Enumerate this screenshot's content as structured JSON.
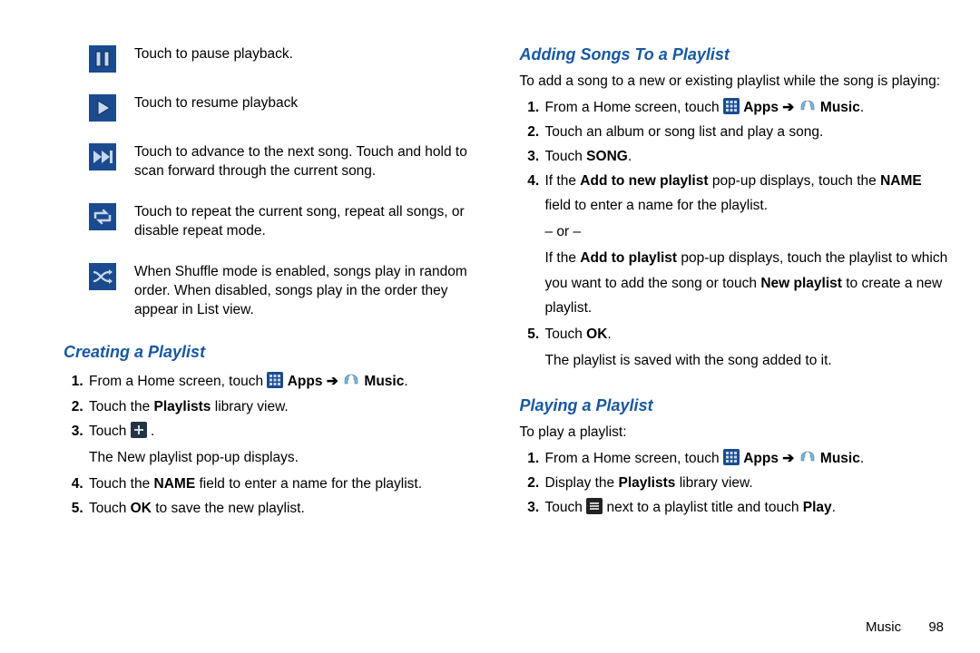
{
  "controls": [
    {
      "text": "Touch to pause playback."
    },
    {
      "text": "Touch to resume playback"
    },
    {
      "text": "Touch to advance to the next song. Touch and hold to scan forward through the current song."
    },
    {
      "text": "Touch to repeat the current song, repeat all songs, or disable repeat mode."
    },
    {
      "text": "When Shuffle mode is enabled, songs play in random order. When disabled, songs play in the order they appear in List view."
    }
  ],
  "creating": {
    "heading": "Creating a Playlist",
    "s1_pre": "From a Home screen, touch ",
    "apps": "Apps",
    "music": "Music",
    "period": ".",
    "s2_pre": "Touch the ",
    "s2_b": "Playlists",
    "s2_post": " library view.",
    "s3_pre": "Touch ",
    "s3_post": " .",
    "s3_sub": "The New playlist pop-up displays.",
    "s4_pre": "Touch the ",
    "s4_b": "NAME",
    "s4_post": " field to enter a name for the playlist.",
    "s5_pre": "Touch ",
    "s5_b": "OK",
    "s5_post": " to save the new playlist."
  },
  "adding": {
    "heading": "Adding Songs To a Playlist",
    "intro": "To add a song to a new or existing playlist while the song is playing:",
    "s1_pre": "From a Home screen, touch ",
    "apps": "Apps",
    "music": "Music",
    "period": ".",
    "s2": "Touch an album or song list and play a song.",
    "s3_pre": "Touch ",
    "s3_b": "SONG",
    "s3_post": ".",
    "s4_pre": "If the ",
    "s4_b1": "Add to new playlist",
    "s4_mid": " pop-up displays, touch the ",
    "s4_b2": "NAME",
    "s4_post": " field to enter a name for the playlist.",
    "s4_or": "– or –",
    "s4b_pre": "If the ",
    "s4b_b1": "Add to playlist",
    "s4b_mid": " pop-up displays, touch the playlist to which you want to add the song or touch ",
    "s4b_b2": "New playlist",
    "s4b_post": " to create a new playlist.",
    "s5_pre": "Touch ",
    "s5_b": "OK",
    "s5_post": ".",
    "s5_sub": "The playlist is saved with the song added to it."
  },
  "playing": {
    "heading": "Playing a Playlist",
    "intro": "To play a playlist:",
    "s1_pre": "From a Home screen, touch ",
    "apps": "Apps",
    "music": "Music",
    "period": ".",
    "s2_pre": "Display the ",
    "s2_b": "Playlists",
    "s2_post": " library view.",
    "s3_pre": "Touch ",
    "s3_mid": " next to a playlist title and touch ",
    "s3_b": "Play",
    "s3_post": "."
  },
  "labels": {
    "arrow": "➔"
  },
  "footer": {
    "section": "Music",
    "page": "98"
  }
}
